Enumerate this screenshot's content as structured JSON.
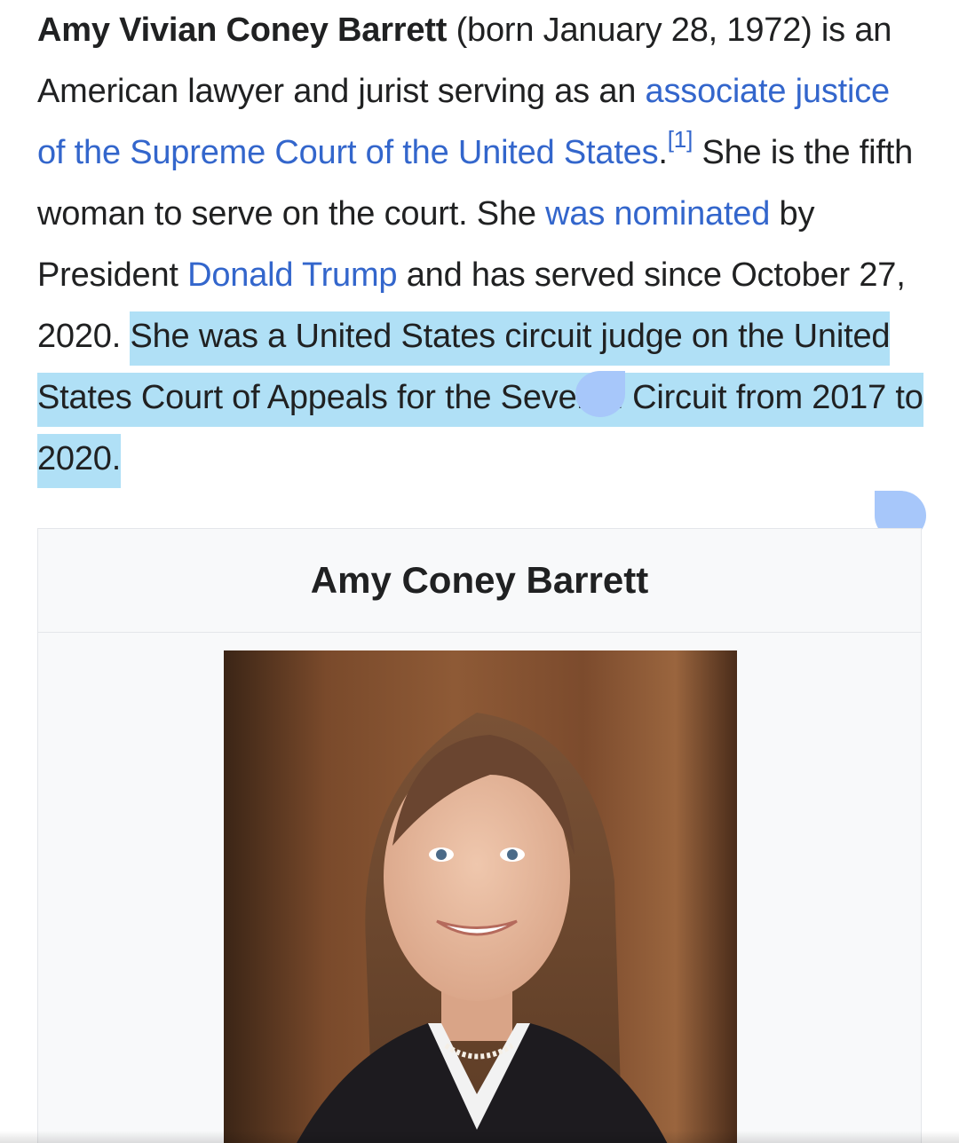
{
  "article": {
    "subject_bold": "Amy Vivian Coney Barrett",
    "t1": " (born January 28, 1972) is an American lawyer and jurist serving as an ",
    "link_associate_justice": "associate justice of the Supreme Court of the United States",
    "t2": ".",
    "ref_1": "[1]",
    "t3": " She is the fifth woman to serve on the court. She ",
    "link_was_nominated": "was nominated",
    "t4": " by President ",
    "link_donald_trump": "Donald Trump",
    "t5": " and has served since October 27, 2020. ",
    "selected_text": "She was a United States circuit judge on the United States Court of Appeals for the Seventh Circuit from 2017 to 2020."
  },
  "infobox": {
    "title": "Amy Coney Barrett"
  },
  "colors": {
    "link": "#3366cc",
    "selection": "#b0e0f6",
    "selection_handle": "#a7c7fa"
  }
}
